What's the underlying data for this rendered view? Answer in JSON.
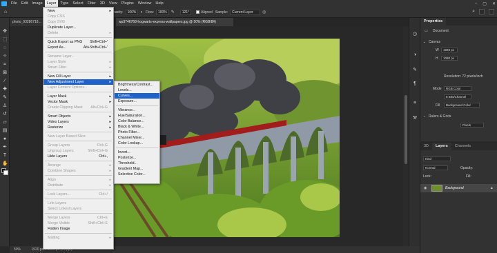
{
  "menubar": {
    "items": [
      "File",
      "Edit",
      "Image",
      "Layer",
      "Type",
      "Select",
      "Filter",
      "3D",
      "View",
      "Plugins",
      "Window",
      "Help"
    ],
    "active": "Layer"
  },
  "optbar": {
    "opacity_label": "Opacity:",
    "opacity_value": "100%",
    "flow_label": "Flow:",
    "flow_value": "100%",
    "angle_value": "121°",
    "aligned_label": "Aligned",
    "sample_label": "Sample:",
    "sample_value": "Current Layer"
  },
  "tabs": [
    {
      "label": "photo_93286718...",
      "active": false
    },
    {
      "label": "wp3746768-hogwarts-express-wallpapers.jpg @ 50% (RGB/8#)",
      "active": true
    }
  ],
  "statusbar": {
    "zoom": "50%",
    "info": "1920 px x 1080 px (72 ppi)"
  },
  "layer_menu": {
    "items": [
      {
        "label": "New",
        "disabled": false,
        "submenu": true
      },
      {
        "label": "Copy CSS",
        "disabled": true
      },
      {
        "label": "Copy SVG",
        "disabled": true
      },
      {
        "label": "Duplicate Layer...",
        "disabled": false
      },
      {
        "label": "Delete",
        "disabled": true,
        "submenu": true
      },
      {
        "sep": true
      },
      {
        "label": "Quick Export as PNG",
        "shortcut": "Shift+Ctrl+'",
        "disabled": false
      },
      {
        "label": "Export As...",
        "shortcut": "Alt+Shift+Ctrl+'",
        "disabled": false
      },
      {
        "sep": true
      },
      {
        "label": "Rename Layer...",
        "disabled": true
      },
      {
        "label": "Layer Style",
        "disabled": true,
        "submenu": true
      },
      {
        "label": "Smart Filter",
        "disabled": true,
        "submenu": true
      },
      {
        "sep": true
      },
      {
        "label": "New Fill Layer",
        "disabled": false,
        "submenu": true
      },
      {
        "label": "New Adjustment Layer",
        "disabled": false,
        "submenu": true,
        "highlighted": true
      },
      {
        "label": "Layer Content Options...",
        "disabled": true
      },
      {
        "sep": true
      },
      {
        "label": "Layer Mask",
        "disabled": false,
        "submenu": true
      },
      {
        "label": "Vector Mask",
        "disabled": false,
        "submenu": true
      },
      {
        "label": "Create Clipping Mask",
        "shortcut": "Alt+Ctrl+G",
        "disabled": true
      },
      {
        "sep": true
      },
      {
        "label": "Smart Objects",
        "disabled": false,
        "submenu": true
      },
      {
        "label": "Video Layers",
        "disabled": false,
        "submenu": true
      },
      {
        "label": "Rasterize",
        "disabled": false,
        "submenu": true
      },
      {
        "sep": true
      },
      {
        "label": "New Layer Based Slice",
        "disabled": true
      },
      {
        "sep": true
      },
      {
        "label": "Group Layers",
        "shortcut": "Ctrl+G",
        "disabled": true
      },
      {
        "label": "Ungroup Layers",
        "shortcut": "Shift+Ctrl+G",
        "disabled": true
      },
      {
        "label": "Hide Layers",
        "shortcut": "Ctrl+,",
        "disabled": false
      },
      {
        "sep": true
      },
      {
        "label": "Arrange",
        "disabled": true,
        "submenu": true
      },
      {
        "label": "Combine Shapes",
        "disabled": true,
        "submenu": true
      },
      {
        "sep": true
      },
      {
        "label": "Align",
        "disabled": true,
        "submenu": true
      },
      {
        "label": "Distribute",
        "disabled": true,
        "submenu": true
      },
      {
        "sep": true
      },
      {
        "label": "Lock Layers...",
        "shortcut": "Ctrl+/",
        "disabled": true
      },
      {
        "sep": true
      },
      {
        "label": "Link Layers",
        "disabled": true
      },
      {
        "label": "Select Linked Layers",
        "disabled": true
      },
      {
        "sep": true
      },
      {
        "label": "Merge Layers",
        "shortcut": "Ctrl+E",
        "disabled": true
      },
      {
        "label": "Merge Visible",
        "shortcut": "Shift+Ctrl+E",
        "disabled": true
      },
      {
        "label": "Flatten Image",
        "disabled": false
      },
      {
        "sep": true
      },
      {
        "label": "Matting",
        "disabled": true,
        "submenu": true
      }
    ]
  },
  "adjustment_submenu": {
    "items": [
      {
        "label": "Brightness/Contrast..."
      },
      {
        "label": "Levels..."
      },
      {
        "label": "Curves...",
        "highlighted": true
      },
      {
        "label": "Exposure..."
      },
      {
        "sep": true
      },
      {
        "label": "Vibrance..."
      },
      {
        "label": "Hue/Saturation..."
      },
      {
        "label": "Color Balance..."
      },
      {
        "label": "Black & White..."
      },
      {
        "label": "Photo Filter..."
      },
      {
        "label": "Channel Mixer..."
      },
      {
        "label": "Color Lookup..."
      },
      {
        "sep": true
      },
      {
        "label": "Invert..."
      },
      {
        "label": "Posterize..."
      },
      {
        "label": "Threshold..."
      },
      {
        "label": "Gradient Map..."
      },
      {
        "label": "Selective Color..."
      }
    ]
  },
  "properties": {
    "tab": "Properties",
    "doc_label": "Document",
    "canvas_section": "Canvas",
    "w_label": "W",
    "w_value": "1920 px",
    "h_label": "H",
    "h_value": "1080 px",
    "resolution": "Resolution: 72 pixels/inch",
    "mode_label": "Mode",
    "mode_value": "RGB Color",
    "depth_value": "8 Bits/Channel",
    "fill_label": "Fill",
    "fill_value": "Background Color",
    "rulers_section": "Rulers & Grids",
    "units_value": "Pixels"
  },
  "layers_panel": {
    "tabs": [
      "3D",
      "Layers",
      "Channels"
    ],
    "active_tab": "Layers",
    "kind_label": "Kind",
    "blend_value": "Normal",
    "opacity_label": "Opacity:",
    "lock_label": "Lock:",
    "fill_label": "Fill:",
    "layer_name": "Background"
  }
}
